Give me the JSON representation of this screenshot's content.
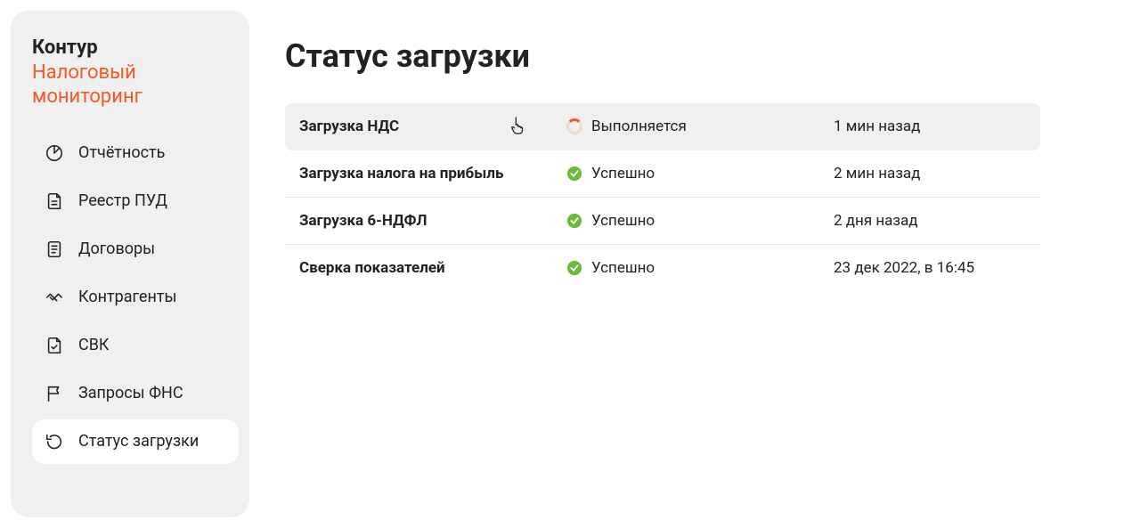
{
  "brand": {
    "top": "Контур",
    "sub_line1": "Налоговый",
    "sub_line2": "мониторинг"
  },
  "sidebar": {
    "items": [
      {
        "id": "reporting",
        "label": "Отчётность",
        "active": false
      },
      {
        "id": "registry-pud",
        "label": "Реестр ПУД",
        "active": false
      },
      {
        "id": "contracts",
        "label": "Договоры",
        "active": false
      },
      {
        "id": "counterparties",
        "label": "Контрагенты",
        "active": false
      },
      {
        "id": "svk",
        "label": "СВК",
        "active": false
      },
      {
        "id": "fns-requests",
        "label": "Запросы ФНС",
        "active": false
      },
      {
        "id": "upload-status",
        "label": "Статус загрузки",
        "active": true
      }
    ]
  },
  "page": {
    "title": "Статус загрузки"
  },
  "uploads": [
    {
      "name": "Загрузка НДС",
      "status_label": "Выполняется",
      "status": "running",
      "time": "1 мин назад",
      "hover": true
    },
    {
      "name": "Загрузка налога на прибыль",
      "status_label": "Успешно",
      "status": "ok",
      "time": "2 мин назад",
      "hover": false
    },
    {
      "name": "Загрузка 6-НДФЛ",
      "status_label": "Успешно",
      "status": "ok",
      "time": "2 дня назад",
      "hover": false
    },
    {
      "name": "Сверка показателей",
      "status_label": "Успешно",
      "status": "ok",
      "time": "23 дек 2022, в 16:45",
      "hover": false
    }
  ]
}
